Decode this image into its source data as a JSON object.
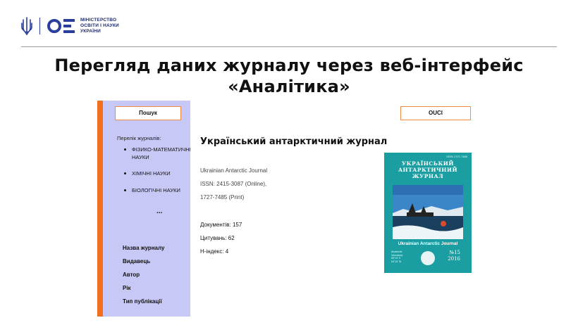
{
  "header": {
    "ministry_lines": [
      "МІНІСТЕРСТВО",
      "ОСВІТИ І НАУКИ",
      "УКРАЇНИ"
    ],
    "brand_color": "#2a3f9c"
  },
  "slide_title_lines": [
    "Перегляд даних журналу через веб-інтерфейс",
    "«Аналітика»"
  ],
  "sidebar": {
    "search_button": "Пошук",
    "journals_label": "Перелік журналів:",
    "journals": [
      "ФІЗИКО-МАТЕМАТИЧНІ НАУКИ",
      "ХІМІЧНІ НАУКИ",
      "БІОЛОГІЧНІ НАУКИ"
    ],
    "more": "...",
    "filters": [
      "Назва журналу",
      "Видавець",
      "Автор",
      "Рік",
      "Тип публікації"
    ],
    "accent_color": "#f26f1c",
    "background_color": "#c8c8f7"
  },
  "main": {
    "ouci_button": "OUCI",
    "journal_title": "Український антарктичний журнал",
    "english_title": "Ukrainian Antarctic Journal",
    "issn_line1": "ISSN: 2415-3087 (Online),",
    "issn_line2": "1727-7485 (Print)",
    "metrics": {
      "documents": "Документів: 157",
      "citations": "Цитувань: 62",
      "h_index": "H-індекс:  4"
    }
  },
  "cover": {
    "issn": "ISSN 1727-7485",
    "title_lines": [
      "УКРАЇНСЬКИЙ",
      "АНТАРКТИЧНИЙ",
      "ЖУРНАЛ"
    ],
    "subtitle": "Ukrainian Antarctic Journal",
    "small_lines": [
      "Akademik",
      "Vernadsky",
      "65°15' S",
      "64°16' W"
    ],
    "issue": "№15",
    "year": "2016",
    "color": "#1a9ea1"
  }
}
